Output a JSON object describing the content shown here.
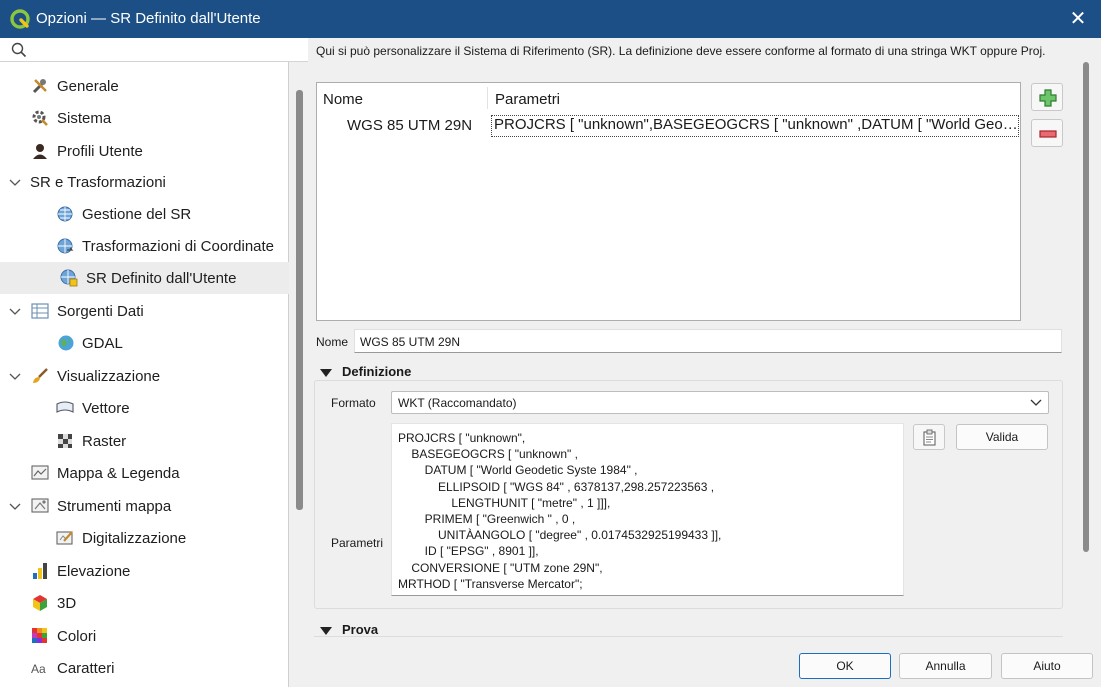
{
  "window": {
    "title": "Opzioni — SR Definito dall'Utente",
    "close_glyph": "✕"
  },
  "sidebar": {
    "search_placeholder": "",
    "items": [
      {
        "label": "Generale",
        "icon": "tools-icon",
        "level": 0
      },
      {
        "label": "Sistema",
        "icon": "system-gear-icon",
        "level": 0
      },
      {
        "label": "Profili Utente",
        "icon": "user-profile-icon",
        "level": 0
      },
      {
        "label": "SR e Trasformazioni",
        "icon": "",
        "level": 0,
        "expanded": true
      },
      {
        "label": "Gestione del SR",
        "icon": "globe-icon",
        "level": 1
      },
      {
        "label": "Trasformazioni di Coordinate",
        "icon": "globe-transform-icon",
        "level": 1
      },
      {
        "label": "SR Definito dall'Utente",
        "icon": "globe-user-icon",
        "level": 1,
        "selected": true
      },
      {
        "label": "Sorgenti Dati",
        "icon": "table-icon",
        "level": 0,
        "expanded": true
      },
      {
        "label": "GDAL",
        "icon": "gdal-globe-icon",
        "level": 1
      },
      {
        "label": "Visualizzazione",
        "icon": "brush-icon",
        "level": 0,
        "expanded": true
      },
      {
        "label": "Vettore",
        "icon": "vector-icon",
        "level": 1
      },
      {
        "label": "Raster",
        "icon": "raster-icon",
        "level": 1
      },
      {
        "label": "Mappa & Legenda",
        "icon": "map-legend-icon",
        "level": 0
      },
      {
        "label": "Strumenti mappa",
        "icon": "map-tools-icon",
        "level": 0,
        "expanded": true
      },
      {
        "label": "Digitalizzazione",
        "icon": "digitize-icon",
        "level": 1
      },
      {
        "label": "Elevazione",
        "icon": "elevation-icon",
        "level": 0
      },
      {
        "label": "3D",
        "icon": "cube-3d-icon",
        "level": 0
      },
      {
        "label": "Colori",
        "icon": "color-palette-icon",
        "level": 0
      },
      {
        "label": "Caratteri",
        "icon": "font-icon",
        "level": 0
      }
    ]
  },
  "main": {
    "description": "Qui si può personalizzare il Sistema di Riferimento (SR). La definizione deve essere conforme al formato di una stringa WKT oppure Proj.",
    "table": {
      "headers": [
        "Nome",
        "Parametri"
      ],
      "rows": [
        {
          "name": "WGS 85 UTM 29N",
          "params": "PROJCRS [ \"unknown\",BASEGEOGCRS [ \"unknown\" ,DATUM [ \"World Geodeti..."
        }
      ]
    },
    "name_label": "Nome",
    "name_value": "WGS 85 UTM 29N",
    "definition": {
      "header": "Definizione",
      "format_label": "Formato",
      "format_value": "WKT (Raccomandato)",
      "params_label": "Parametri",
      "params_text": "PROJCRS [ \"unknown\",\n    BASEGEOGCRS [ \"unknown\" ,\n        DATUM [ \"World Geodetic Syste 1984\" ,\n            ELLIPSOID [ \"WGS 84\" , 6378137,298.257223563 ,\n                LENGTHUNIT [ \"metre\" , 1 ]]],\n        PRIMEM [ \"Greenwich \" , 0 ,\n            UNITÀANGOLO [ \"degree\" , 0.0174532925199433 ]],\n        ID [ \"EPSG\" , 8901 ]],\n    CONVERSIONE [ \"UTM zone 29N\",\nMRTHOD [ \"Transverse Mercator\";",
      "validate_label": "Valida"
    },
    "test": {
      "header": "Prova"
    }
  },
  "footer": {
    "ok_label": "OK",
    "cancel_label": "Annulla",
    "help_label": "Aiuto"
  },
  "colors": {
    "titlebar": "#1c4f86",
    "add_green": "#3aa33a",
    "remove_red": "#d9434a",
    "primary_border": "#1c6fc0"
  }
}
